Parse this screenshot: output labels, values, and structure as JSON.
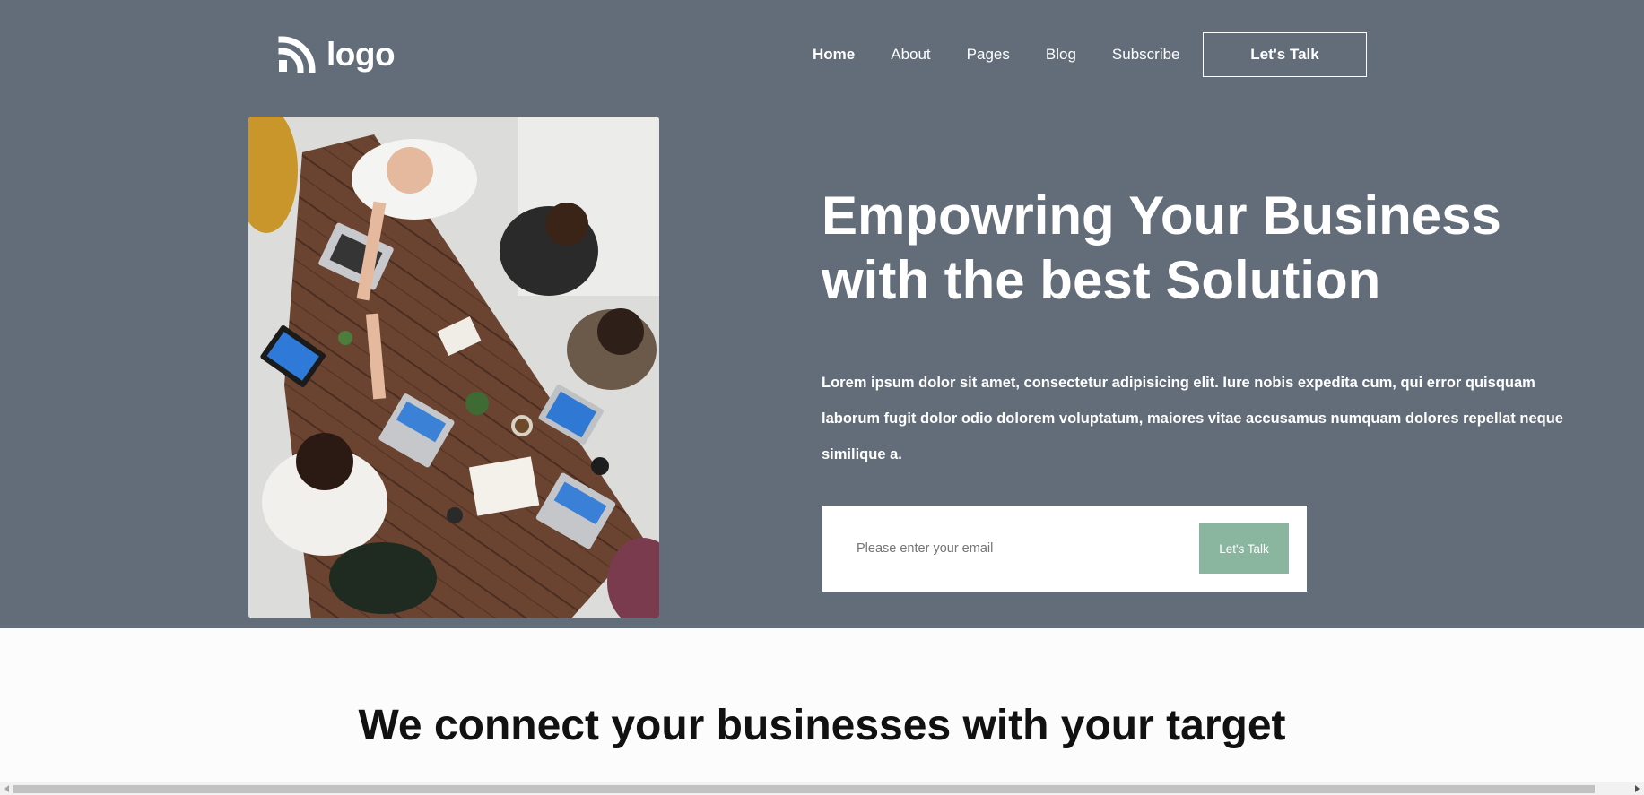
{
  "header": {
    "logo_text": "logo",
    "nav": [
      "Home",
      "About",
      "Pages",
      "Blog",
      "Subscribe"
    ],
    "active_nav": "Home",
    "cta_label": "Let's Talk"
  },
  "hero": {
    "title": "Empowring Your Business with the best Solution",
    "description": "Lorem ipsum dolor sit amet, consectetur adipisicing elit. Iure nobis expedita cum, qui error quisquam laborum fugit dolor odio dolorem voluptatum, maiores vitae accusamus numquam dolores repellat neque similique a.",
    "email_placeholder": "Please enter your email",
    "signup_button": "Let's Talk",
    "photo_icon": "team-meeting-photo"
  },
  "section": {
    "title": "We connect your businesses with your target"
  },
  "colors": {
    "hero_bg": "#636d7a",
    "accent": "#8ab69f",
    "page_bg": "#fcfcfd"
  }
}
